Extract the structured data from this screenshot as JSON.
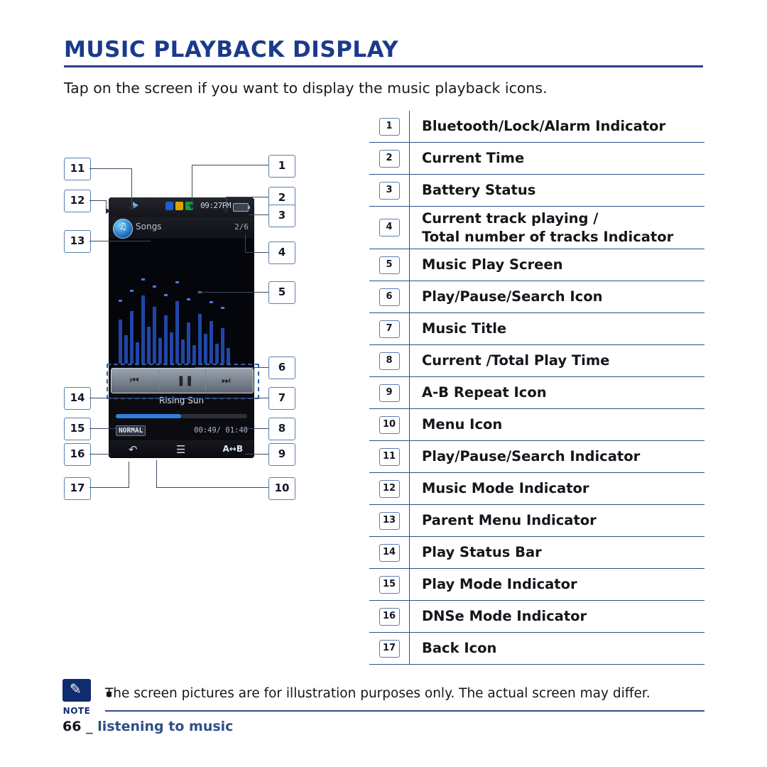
{
  "header": {
    "title": "MUSIC PLAYBACK DISPLAY",
    "intro": "Tap on the screen if you want to display the music playback icons."
  },
  "device": {
    "status_icons": [
      "play-indicator",
      "bluetooth-icon",
      "lock-icon",
      "alarm-icon"
    ],
    "time": "09:27PM",
    "battery": "battery-icon",
    "parent_menu_label": "Songs",
    "track_count": "2/6",
    "controls": [
      "prev-button",
      "pause-button",
      "next-button"
    ],
    "music_title": "Rising Sun",
    "dnse_mode": "NORMAL",
    "play_times": "00:49/ 01:40",
    "back_key": "back-icon",
    "menu_key": "menu-icon",
    "ab_key": "A↔B"
  },
  "callouts": [
    "1",
    "2",
    "3",
    "4",
    "5",
    "6",
    "7",
    "8",
    "9",
    "10",
    "11",
    "12",
    "13",
    "14",
    "15",
    "16",
    "17"
  ],
  "legend": [
    {
      "num": "1",
      "label": "Bluetooth/Lock/Alarm Indicator"
    },
    {
      "num": "2",
      "label": "Current Time"
    },
    {
      "num": "3",
      "label": "Battery Status"
    },
    {
      "num": "4",
      "label": "Current track playing /",
      "label2": "Total number of tracks Indicator"
    },
    {
      "num": "5",
      "label": "Music Play Screen"
    },
    {
      "num": "6",
      "label": "Play/Pause/Search Icon"
    },
    {
      "num": "7",
      "label": "Music Title"
    },
    {
      "num": "8",
      "label": "Current /Total Play Time"
    },
    {
      "num": "9",
      "label": "A-B Repeat Icon"
    },
    {
      "num": "10",
      "label": "Menu Icon"
    },
    {
      "num": "11",
      "label": "Play/Pause/Search Indicator"
    },
    {
      "num": "12",
      "label": "Music Mode Indicator"
    },
    {
      "num": "13",
      "label": "Parent Menu Indicator"
    },
    {
      "num": "14",
      "label": "Play Status Bar"
    },
    {
      "num": "15",
      "label": "Play Mode Indicator"
    },
    {
      "num": "16",
      "label": "DNSe Mode Indicator"
    },
    {
      "num": "17",
      "label": "Back Icon"
    }
  ],
  "note": {
    "label": "NOTE",
    "text": "The screen pictures are for illustration purposes only. The actual screen may differ."
  },
  "footer": {
    "page": "66",
    "separator": " _ ",
    "section": "listening to music"
  }
}
